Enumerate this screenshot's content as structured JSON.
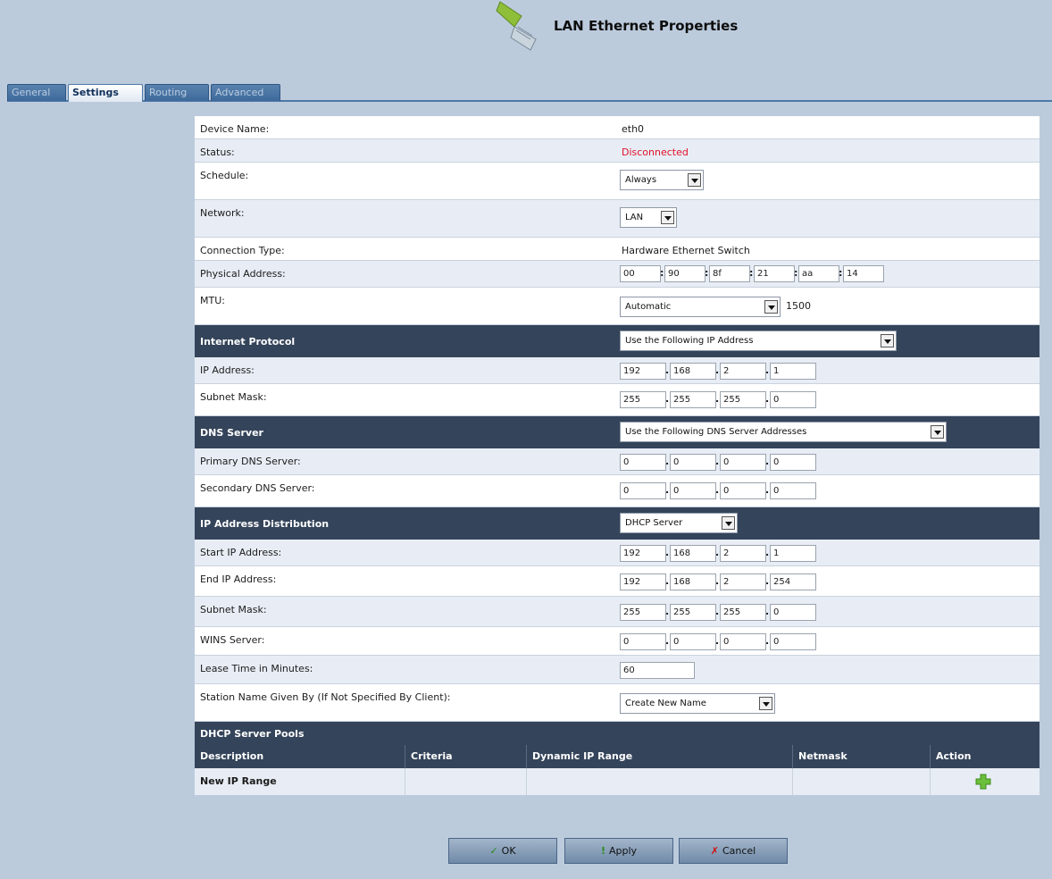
{
  "header": {
    "title": "LAN Ethernet Properties",
    "icon": "ethernet-cable-icon"
  },
  "tabs": [
    {
      "label": "General",
      "active": false
    },
    {
      "label": "Settings",
      "active": true
    },
    {
      "label": "Routing",
      "active": false
    },
    {
      "label": "Advanced",
      "active": false
    }
  ],
  "fields": {
    "device_name": {
      "label": "Device Name:",
      "value": "eth0"
    },
    "status": {
      "label": "Status:",
      "value": "Disconnected",
      "color": "#e0102a"
    },
    "schedule": {
      "label": "Schedule:",
      "value": "Always"
    },
    "network": {
      "label": "Network:",
      "value": "LAN"
    },
    "connection_type": {
      "label": "Connection Type:",
      "value": "Hardware Ethernet Switch"
    },
    "physical_address": {
      "label": "Physical Address:",
      "octets": [
        "00",
        "90",
        "8f",
        "21",
        "aa",
        "14"
      ]
    },
    "mtu": {
      "label": "MTU:",
      "value": "Automatic",
      "number": "1500"
    }
  },
  "internet_protocol": {
    "header": "Internet Protocol",
    "mode": "Use the Following IP Address",
    "ip_address": {
      "label": "IP Address:",
      "octets": [
        "192",
        "168",
        "2",
        "1"
      ]
    },
    "subnet_mask": {
      "label": "Subnet Mask:",
      "octets": [
        "255",
        "255",
        "255",
        "0"
      ]
    }
  },
  "dns": {
    "header": "DNS Server",
    "mode": "Use the Following DNS Server Addresses",
    "primary": {
      "label": "Primary DNS Server:",
      "octets": [
        "0",
        "0",
        "0",
        "0"
      ]
    },
    "secondary": {
      "label": "Secondary DNS Server:",
      "octets": [
        "0",
        "0",
        "0",
        "0"
      ]
    }
  },
  "ip_distribution": {
    "header": "IP Address Distribution",
    "mode": "DHCP Server",
    "start_ip": {
      "label": "Start IP Address:",
      "octets": [
        "192",
        "168",
        "2",
        "1"
      ]
    },
    "end_ip": {
      "label": "End IP Address:",
      "octets": [
        "192",
        "168",
        "2",
        "254"
      ]
    },
    "subnet_mask": {
      "label": "Subnet Mask:",
      "octets": [
        "255",
        "255",
        "255",
        "0"
      ]
    },
    "wins": {
      "label": "WINS Server:",
      "octets": [
        "0",
        "0",
        "0",
        "0"
      ]
    },
    "lease": {
      "label": "Lease Time in Minutes:",
      "value": "60"
    },
    "station_name": {
      "label": "Station Name Given By (If Not Specified By Client):",
      "value": "Create New Name"
    }
  },
  "pools": {
    "header": "DHCP Server Pools",
    "columns": [
      "Description",
      "Criteria",
      "Dynamic IP Range",
      "Netmask",
      "Action"
    ],
    "rows": [
      {
        "description": "New IP Range",
        "criteria": "",
        "range": "",
        "netmask": ""
      }
    ],
    "add_icon": "add-plus-icon"
  },
  "buttons": {
    "ok": "OK",
    "apply": "Apply",
    "cancel": "Cancel"
  }
}
